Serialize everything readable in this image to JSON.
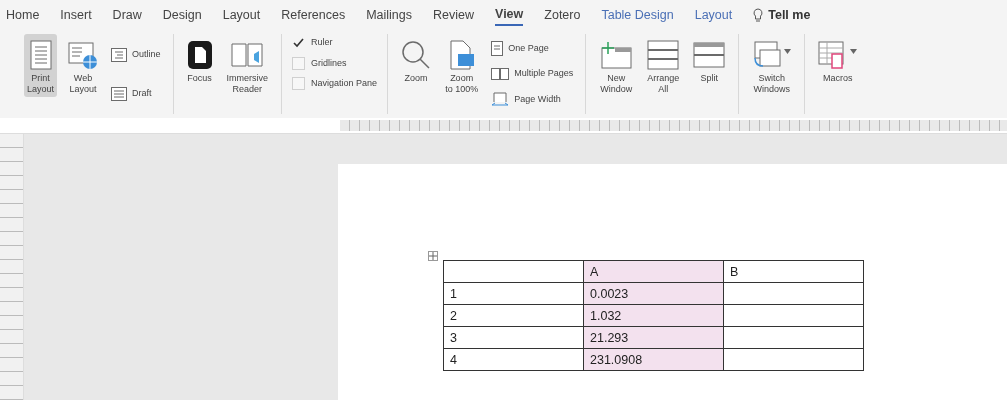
{
  "tabs": [
    {
      "label": "Home",
      "selected": false,
      "kind": "normal"
    },
    {
      "label": "Insert",
      "selected": false,
      "kind": "normal"
    },
    {
      "label": "Draw",
      "selected": false,
      "kind": "normal"
    },
    {
      "label": "Design",
      "selected": false,
      "kind": "normal"
    },
    {
      "label": "Layout",
      "selected": false,
      "kind": "normal"
    },
    {
      "label": "References",
      "selected": false,
      "kind": "normal"
    },
    {
      "label": "Mailings",
      "selected": false,
      "kind": "normal"
    },
    {
      "label": "Review",
      "selected": false,
      "kind": "normal"
    },
    {
      "label": "View",
      "selected": true,
      "kind": "normal"
    },
    {
      "label": "Zotero",
      "selected": false,
      "kind": "normal"
    },
    {
      "label": "Table Design",
      "selected": false,
      "kind": "contextual"
    },
    {
      "label": "Layout",
      "selected": false,
      "kind": "contextual"
    }
  ],
  "tell_me": {
    "placeholder": "Tell me"
  },
  "ribbon": [
    {
      "items": [
        {
          "kind": "large",
          "label": "Print\nLayout",
          "selected": true
        },
        {
          "kind": "large",
          "label": "Web\nLayout",
          "selected": false
        },
        {
          "kind": "stack",
          "children": [
            {
              "label": "Outline",
              "selected": false
            },
            {
              "label": "Draft",
              "selected": false
            }
          ]
        }
      ]
    },
    {
      "items": [
        {
          "kind": "large",
          "label": "Focus"
        },
        {
          "kind": "large",
          "label": "Immersive\nReader"
        }
      ]
    },
    {
      "items": [
        {
          "kind": "checks",
          "children": [
            {
              "label": "Ruler",
              "checked": true
            },
            {
              "label": "Gridlines",
              "checked": false
            },
            {
              "label": "Navigation Pane",
              "checked": false
            }
          ]
        }
      ]
    },
    {
      "items": [
        {
          "kind": "large",
          "label": "Zoom"
        },
        {
          "kind": "large",
          "label": "Zoom\nto 100%"
        },
        {
          "kind": "stack",
          "children": [
            {
              "label": "One Page"
            },
            {
              "label": "Multiple Pages"
            },
            {
              "label": "Page Width"
            }
          ]
        }
      ]
    },
    {
      "items": [
        {
          "kind": "large",
          "label": "New\nWindow"
        },
        {
          "kind": "large",
          "label": "Arrange\nAll"
        },
        {
          "kind": "large",
          "label": "Split"
        }
      ]
    },
    {
      "items": [
        {
          "kind": "large",
          "label": "Switch\nWindows",
          "dropdown": true
        }
      ]
    },
    {
      "items": [
        {
          "kind": "large",
          "label": "Macros",
          "dropdown": true
        }
      ]
    }
  ],
  "table": {
    "columns": [
      {
        "selected": false
      },
      {
        "selected": true
      },
      {
        "selected": false
      }
    ],
    "rows": [
      {
        "cells": [
          "",
          "A",
          "B"
        ]
      },
      {
        "cells": [
          "1",
          "0.0023",
          ""
        ]
      },
      {
        "cells": [
          "2",
          "1.032",
          ""
        ]
      },
      {
        "cells": [
          "3",
          "21.293",
          ""
        ]
      },
      {
        "cells": [
          "4",
          "231.0908",
          ""
        ]
      }
    ]
  }
}
